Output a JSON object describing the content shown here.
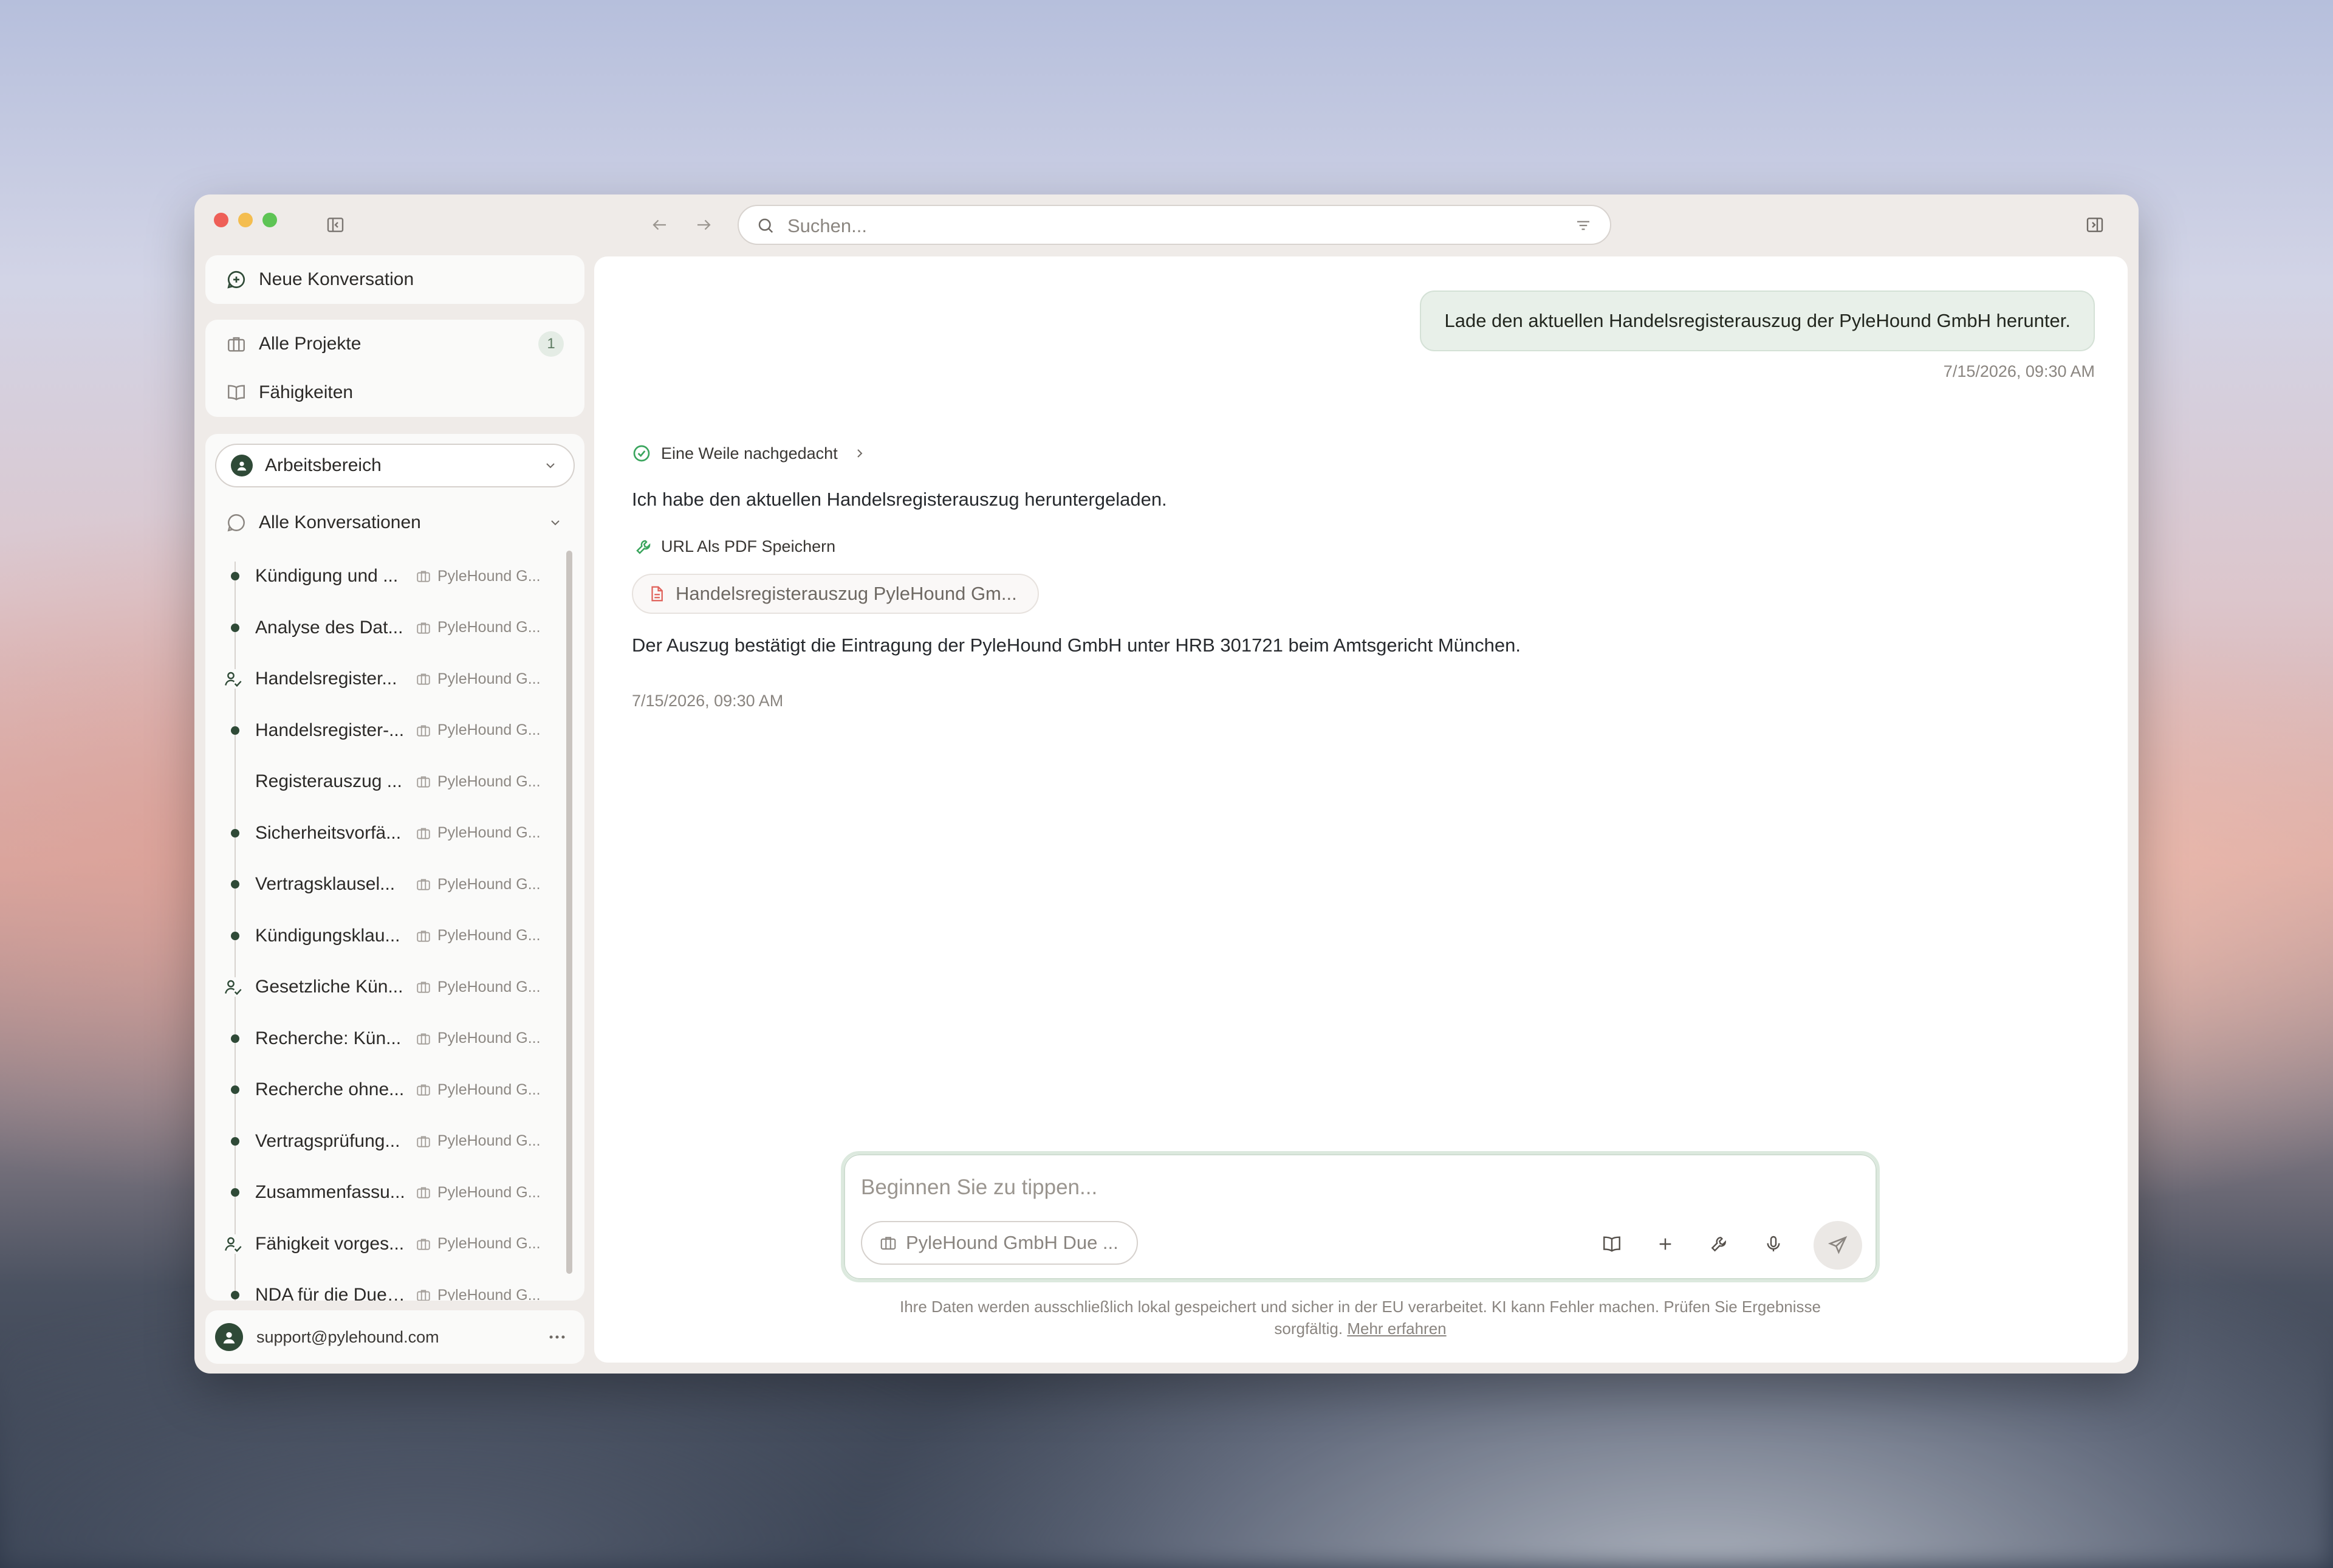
{
  "window": {
    "search_placeholder": "Suchen..."
  },
  "sidebar": {
    "new_conversation": "Neue Konversation",
    "nav": [
      {
        "label": "Alle Projekte",
        "badge": "1"
      },
      {
        "label": "Fähigkeiten"
      }
    ],
    "workspace": "Arbeitsbereich",
    "conversations_header": "Alle Konversationen",
    "conversations": [
      {
        "title": "Kündigung und ...",
        "project": "PyleHound G...",
        "marker": "dot"
      },
      {
        "title": "Analyse des Dat...",
        "project": "PyleHound G...",
        "marker": "dot"
      },
      {
        "title": "Handelsregister...",
        "project": "PyleHound G...",
        "marker": "user"
      },
      {
        "title": "Handelsregister-...",
        "project": "PyleHound G...",
        "marker": "dot"
      },
      {
        "title": "Registerauszug ...",
        "project": "PyleHound G...",
        "marker": "none"
      },
      {
        "title": "Sicherheitsvorfä...",
        "project": "PyleHound G...",
        "marker": "dot"
      },
      {
        "title": "Vertragsklausel...",
        "project": "PyleHound G...",
        "marker": "dot"
      },
      {
        "title": "Kündigungsklau...",
        "project": "PyleHound G...",
        "marker": "dot"
      },
      {
        "title": "Gesetzliche Kün...",
        "project": "PyleHound G...",
        "marker": "user"
      },
      {
        "title": "Recherche: Kün...",
        "project": "PyleHound G...",
        "marker": "dot"
      },
      {
        "title": "Recherche ohne...",
        "project": "PyleHound G...",
        "marker": "dot"
      },
      {
        "title": "Vertragsprüfung...",
        "project": "PyleHound G...",
        "marker": "dot"
      },
      {
        "title": "Zusammenfassu...",
        "project": "PyleHound G...",
        "marker": "dot"
      },
      {
        "title": "Fähigkeit vorges...",
        "project": "PyleHound G...",
        "marker": "user"
      },
      {
        "title": "NDA für die Due ...",
        "project": "PyleHound G...",
        "marker": "dot"
      }
    ],
    "user_email": "support@pylehound.com"
  },
  "chat": {
    "user_message": "Lade den aktuellen Handelsregisterauszug der PyleHound GmbH herunter.",
    "user_timestamp": "7/15/2026, 09:30 AM",
    "thinking_label": "Eine Weile nachgedacht",
    "assistant_intro": "Ich habe den aktuellen Handelsregisterauszug heruntergeladen.",
    "tool_label": "URL Als PDF Speichern",
    "file_chip": "Handelsregisterauszug PyleHound Gm...",
    "assistant_result": "Der Auszug bestätigt die Eintragung der PyleHound GmbH unter HRB 301721 beim Amtsgericht München.",
    "assistant_timestamp": "7/15/2026, 09:30 AM"
  },
  "composer": {
    "placeholder": "Beginnen Sie zu tippen...",
    "project_chip": "PyleHound GmbH Due ..."
  },
  "footer": {
    "disclaimer_line1": "Ihre Daten werden ausschließlich lokal gespeichert und sicher in der EU verarbeitet. KI kann Fehler machen. Prüfen Sie Ergebnisse",
    "disclaimer_line2": "sorgfältig.",
    "learn_more": "Mehr erfahren"
  },
  "colors": {
    "accent": "#2f4a37",
    "user_bubble": "#e8f0e9",
    "success": "#3aa55d"
  }
}
